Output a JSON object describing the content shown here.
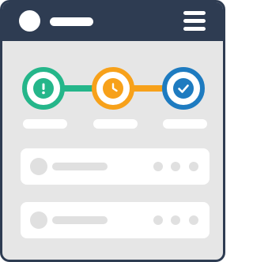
{
  "header": {
    "avatar_icon": "avatar-placeholder",
    "menu_icon": "hamburger-menu-icon",
    "background_color": "#2e3c52"
  },
  "progress": {
    "steps": [
      {
        "state": "alert",
        "icon": "exclamation-icon",
        "color": "#25b68a"
      },
      {
        "state": "pending",
        "icon": "clock-icon",
        "color": "#f7a11a"
      },
      {
        "state": "complete",
        "icon": "checkmark-icon",
        "color": "#1e7bc0"
      }
    ]
  },
  "list": {
    "items": [
      {
        "icon": "item-avatar-placeholder",
        "actions_icon": "more-dots-icon"
      },
      {
        "icon": "item-avatar-placeholder",
        "actions_icon": "more-dots-icon"
      }
    ]
  },
  "colors": {
    "frame": "#2e3c52",
    "content_background": "#e6e6e6",
    "placeholder": "#e0e0e0"
  }
}
